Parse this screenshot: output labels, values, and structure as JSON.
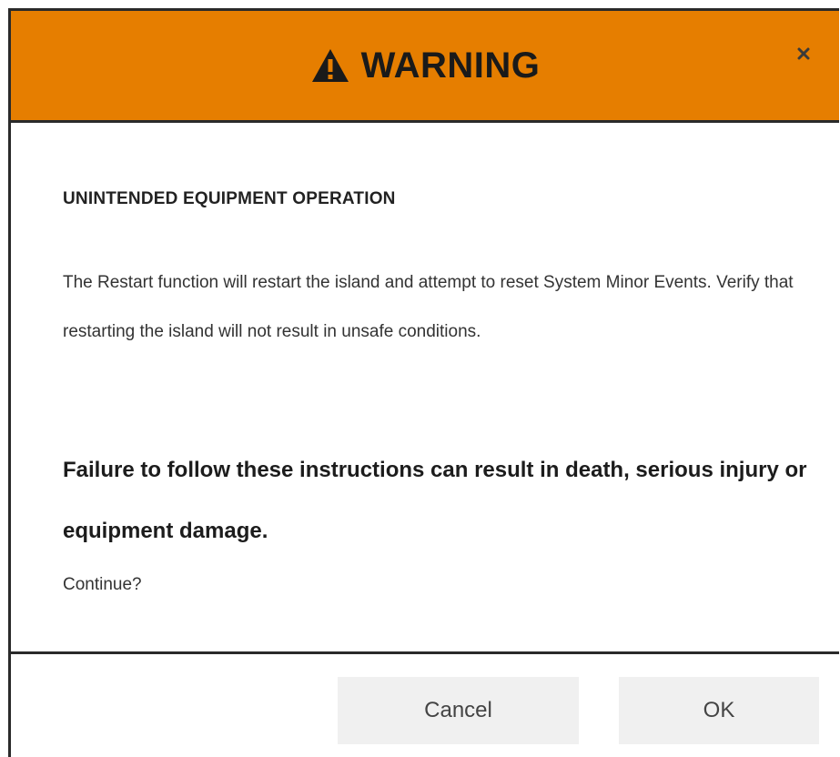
{
  "dialog": {
    "title": "WARNING",
    "title_icon": "warning-triangle-icon",
    "close_icon": "close-icon",
    "header_color": "#e67e00",
    "subtitle": "UNINTENDED EQUIPMENT OPERATION",
    "message": "The Restart function will restart the island and attempt to reset System Minor Events. Verify that restarting the island will not result in unsafe conditions.",
    "critical": "Failure to follow these instructions can result in death, serious injury or equipment damage.",
    "prompt": "Continue?"
  },
  "buttons": {
    "cancel_label": "Cancel",
    "ok_label": "OK"
  }
}
